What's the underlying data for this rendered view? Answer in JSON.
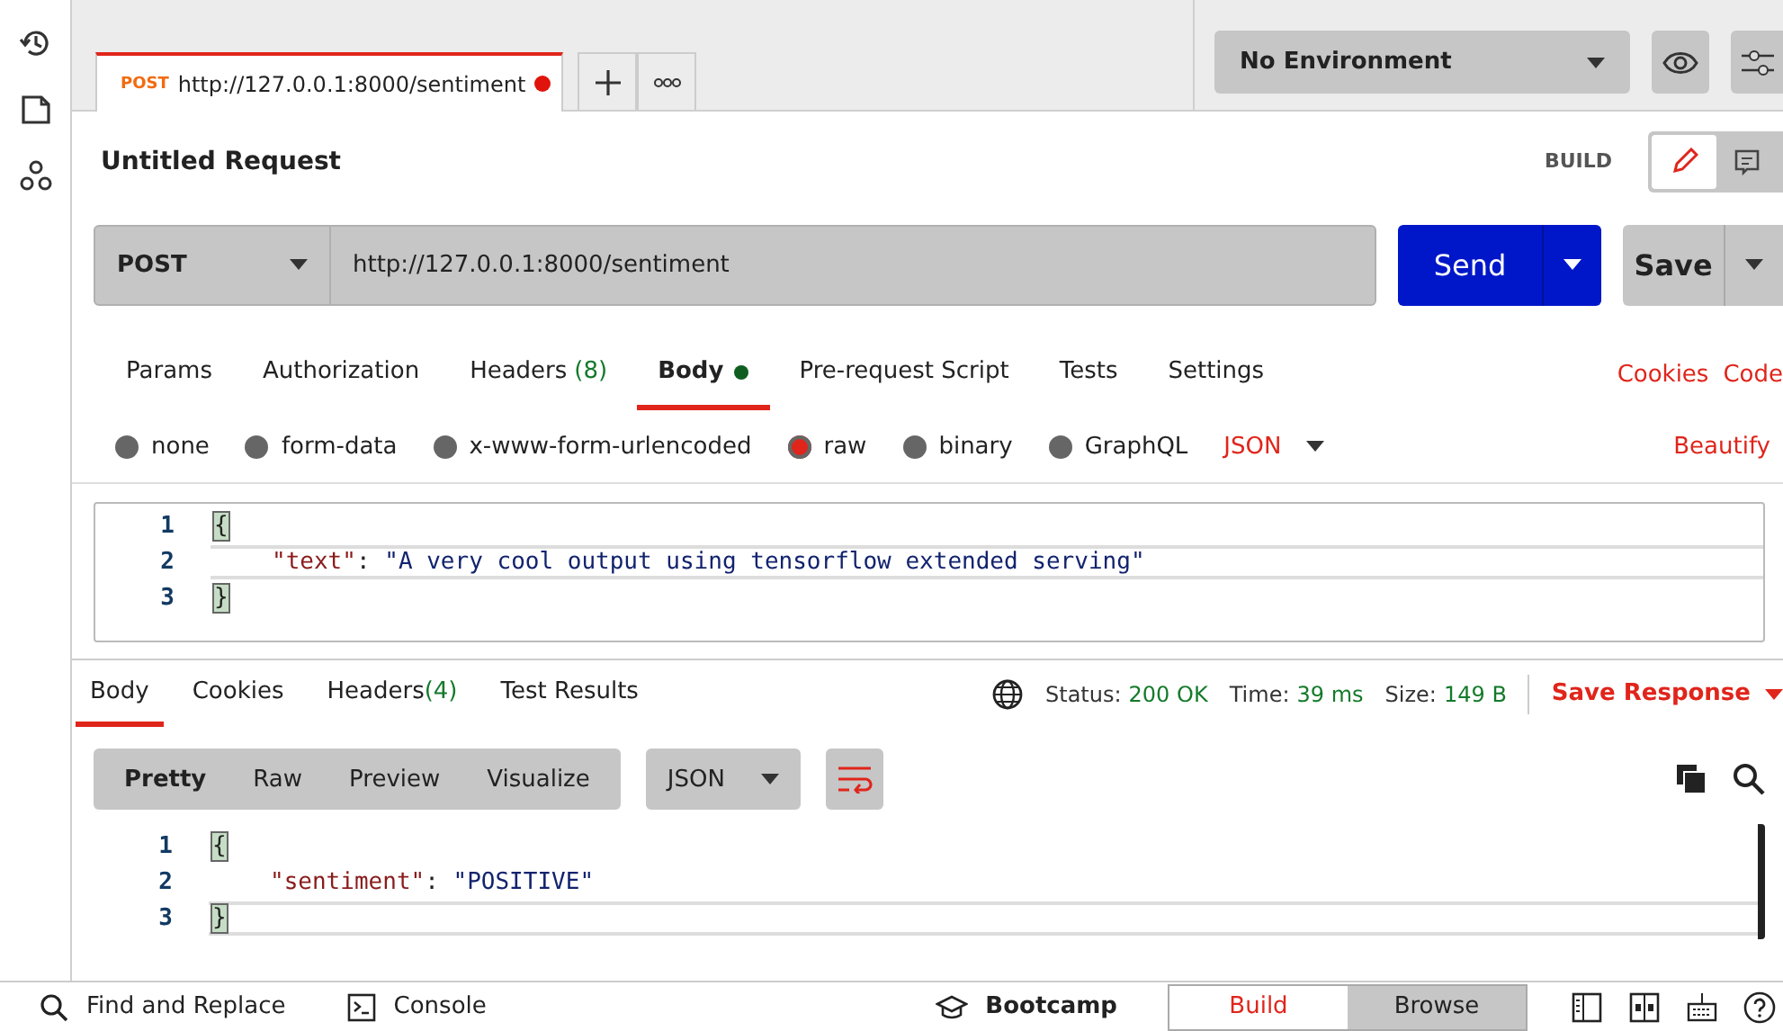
{
  "request_tabs": [
    {
      "method": "POST",
      "url": "http://127.0.0.1:8000/sentiment",
      "unsaved": true,
      "selected": true
    }
  ],
  "environment": {
    "label": "No Environment"
  },
  "request": {
    "title": "Untitled Request",
    "mode_label": "BUILD",
    "method": "POST",
    "url": "http://127.0.0.1:8000/sentiment",
    "send_label": "Send",
    "save_label": "Save",
    "view_toggle": [
      {
        "kind": "edit",
        "selected": true
      },
      {
        "kind": "comments",
        "selected": false
      }
    ]
  },
  "request_sections": [
    {
      "label": "Params",
      "selected": false
    },
    {
      "label": "Authorization",
      "selected": false
    },
    {
      "label": "Headers",
      "count": "(8)",
      "selected": false
    },
    {
      "label": "Body",
      "dot": true,
      "selected": true
    },
    {
      "label": "Pre-request Script",
      "selected": false
    },
    {
      "label": "Tests",
      "selected": false
    },
    {
      "label": "Settings",
      "selected": false
    }
  ],
  "request_links": [
    "Cookies",
    "Code"
  ],
  "body_types": [
    {
      "label": "none",
      "selected": false
    },
    {
      "label": "form-data",
      "selected": false
    },
    {
      "label": "x-www-form-urlencoded",
      "selected": false
    },
    {
      "label": "raw",
      "selected": true
    },
    {
      "label": "binary",
      "selected": false
    },
    {
      "label": "GraphQL",
      "selected": false
    }
  ],
  "body_format": "JSON",
  "beautify_label": "Beautify",
  "request_body": [
    {
      "number": "1",
      "tokens": [
        {
          "kind": "bracket",
          "text": "{"
        }
      ]
    },
    {
      "number": "2",
      "tokens": [
        {
          "kind": "key",
          "text": "\"text\""
        },
        {
          "kind": "punct",
          "text": ": "
        },
        {
          "kind": "string",
          "text": "\"A very cool output using tensorflow extended serving\""
        }
      ]
    },
    {
      "number": "3",
      "tokens": [
        {
          "kind": "bracket",
          "text": "}"
        }
      ]
    }
  ],
  "response_tabs": [
    {
      "label": "Body",
      "selected": true
    },
    {
      "label": "Cookies",
      "selected": false
    },
    {
      "label": "Headers",
      "count": "(4)",
      "selected": false
    },
    {
      "label": "Test Results",
      "selected": false
    }
  ],
  "response_meta": [
    {
      "label": "Status:",
      "value": "200 OK"
    },
    {
      "label": "Time:",
      "value": "39 ms"
    },
    {
      "label": "Size:",
      "value": "149 B"
    }
  ],
  "save_response_label": "Save Response",
  "view_modes": [
    {
      "label": "Pretty",
      "selected": true
    },
    {
      "label": "Raw",
      "selected": false
    },
    {
      "label": "Preview",
      "selected": false
    },
    {
      "label": "Visualize",
      "selected": false
    }
  ],
  "response_format": "JSON",
  "response_body": [
    {
      "number": "1",
      "tokens": [
        {
          "kind": "bracket",
          "text": "{"
        }
      ]
    },
    {
      "number": "2",
      "tokens": [
        {
          "kind": "key",
          "text": "\"sentiment\""
        },
        {
          "kind": "punct",
          "text": ": "
        },
        {
          "kind": "string",
          "text": "\"POSITIVE\""
        }
      ]
    },
    {
      "number": "3",
      "tokens": [
        {
          "kind": "bracket",
          "text": "}"
        }
      ]
    }
  ],
  "footer": {
    "find_label": "Find and Replace",
    "console_label": "Console",
    "bootcamp_label": "Bootcamp",
    "modes": [
      {
        "label": "Build",
        "selected": true
      },
      {
        "label": "Browse",
        "selected": false
      }
    ]
  }
}
